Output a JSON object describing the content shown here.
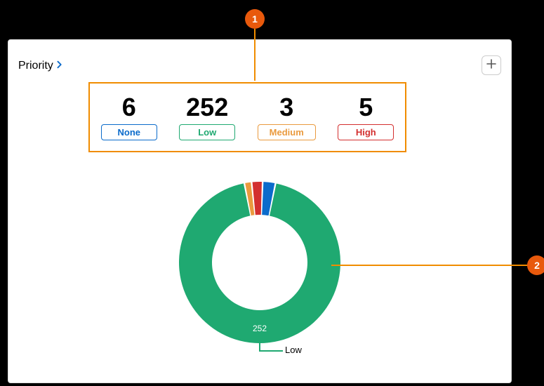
{
  "card": {
    "title": "Priority"
  },
  "stats": [
    {
      "value": "6",
      "label": "None",
      "badge_class": "badge-none"
    },
    {
      "value": "252",
      "label": "Low",
      "badge_class": "badge-low"
    },
    {
      "value": "3",
      "label": "Medium",
      "badge_class": "badge-medium"
    },
    {
      "value": "5",
      "label": "High",
      "badge_class": "badge-high"
    }
  ],
  "callouts": {
    "one": "1",
    "two": "2"
  },
  "chart_data": {
    "type": "pie",
    "title": "Priority",
    "series": [
      {
        "name": "None",
        "value": 6,
        "color": "#0b6bcb"
      },
      {
        "name": "Low",
        "value": 252,
        "color": "#1fa971"
      },
      {
        "name": "Medium",
        "value": 3,
        "color": "#ea9a3e"
      },
      {
        "name": "High",
        "value": 5,
        "color": "#d32f2f"
      }
    ],
    "highlighted_slice": {
      "name": "Low",
      "value_label": "252"
    }
  }
}
